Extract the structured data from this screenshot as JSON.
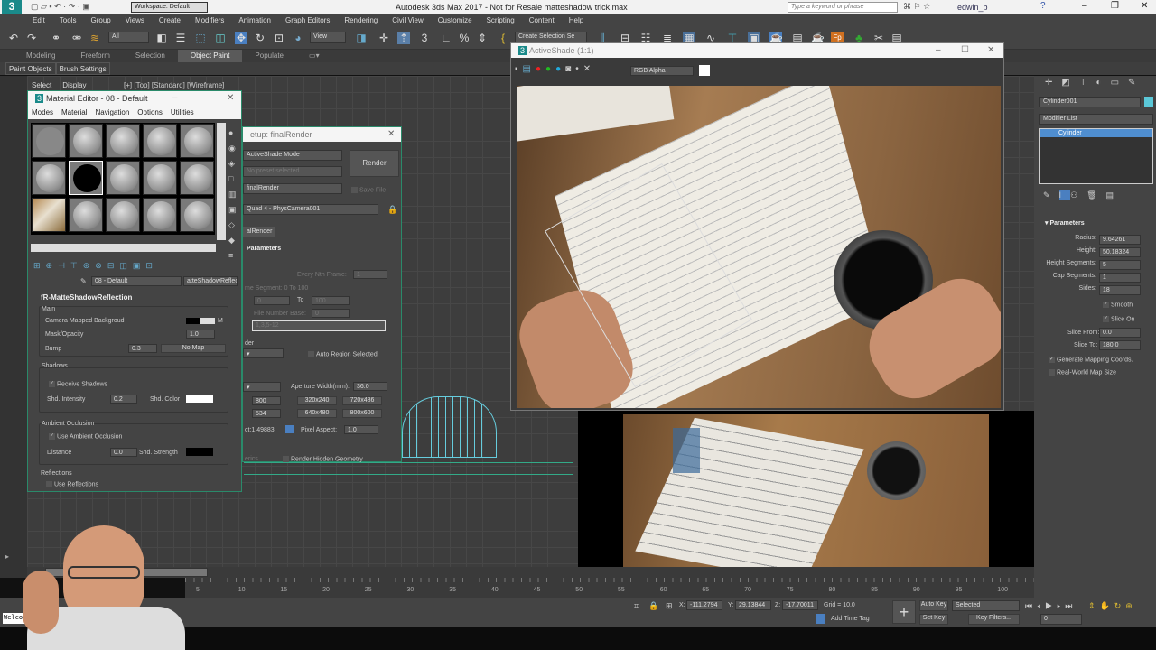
{
  "app": {
    "title": "Autodesk 3ds Max 2017 - Not for Resale   matteshadow trick.max",
    "workspace": "Workspace: Default",
    "search_placeholder": "Type a keyword or phrase",
    "user": "edwin_b"
  },
  "menu": [
    "Edit",
    "Tools",
    "Group",
    "Views",
    "Create",
    "Modifiers",
    "Animation",
    "Graph Editors",
    "Rendering",
    "Civil View",
    "Customize",
    "Scripting",
    "Content",
    "Help"
  ],
  "toolbar": {
    "filter": "All",
    "view": "View",
    "selection_set": "Create Selection Se"
  },
  "ribbon": {
    "tabs": [
      "Modeling",
      "Freeform",
      "Selection",
      "Object Paint",
      "Populate"
    ],
    "active": "Object Paint",
    "subtabs": [
      "Paint Objects",
      "Brush Settings"
    ]
  },
  "viewport": {
    "label": "[+] [Top] [Standard] [Wireframe]",
    "side_tabs": [
      "Select",
      "Display"
    ]
  },
  "material_editor": {
    "title": "Material Editor - 08 - Default",
    "menu": [
      "Modes",
      "Material",
      "Navigation",
      "Options",
      "Utilities"
    ],
    "material_name": "08 - Default",
    "material_type": "atteShadowReflec",
    "rollout": "fR-MatteShadowReflection",
    "main": {
      "title": "Main",
      "camera_bg": "Camera Mapped Backgroud",
      "camera_bg_btn": "M",
      "mask": "Mask/Opacity",
      "mask_val": "1.0",
      "bump": "Bump",
      "bump_val": "0.3",
      "bump_map": "No Map"
    },
    "shadows": {
      "title": "Shadows",
      "receive": "Receive Shadows",
      "intensity": "Shd. Intensity",
      "intensity_val": "0.2",
      "color": "Shd. Color"
    },
    "ao": {
      "title": "Ambient Occlusion",
      "use": "Use Ambient Occlusion",
      "distance": "Distance",
      "distance_val": "0.0",
      "strength": "Shd. Strength"
    },
    "reflections": {
      "title": "Reflections",
      "use": "Use Reflections"
    }
  },
  "render_setup": {
    "title": "etup: finalRender",
    "mode": "ActiveShade Mode",
    "preset": "No preset selected",
    "renderer": "finalRender",
    "render_btn": "Render",
    "save_file": "Save File",
    "view": "Quad 4 - PhysCamera001",
    "tab": "alRender",
    "rollout": "Parameters",
    "every_nth": "Every Nth Frame:",
    "every_nth_val": "1",
    "time_segment": "me Segment:  0 To 100",
    "from": "0",
    "to_lbl": "To",
    "to": "100",
    "file_base": "File Number Base:",
    "file_base_val": "0",
    "frames": "1,3,5-12",
    "section": "der",
    "auto_region": "Auto Region Selected",
    "aperture": "Aperture Width(mm):",
    "aperture_val": "36.0",
    "width": "800",
    "height": "534",
    "presets": [
      "320x240",
      "720x486",
      "640x480",
      "800x600"
    ],
    "aspect": "ct:1.49883",
    "pixel_aspect": "Pixel Aspect:",
    "pixel_aspect_val": "1.0",
    "erics": "erics",
    "hidden": "Render Hidden Geometry"
  },
  "activeshade": {
    "title": "ActiveShade (1:1)",
    "channel": "RGB Alpha"
  },
  "command_panel": {
    "object_name": "Cylinder001",
    "modifier_list": "Modifier List",
    "stack": [
      "Cylinder"
    ],
    "rollout": "Parameters",
    "params": [
      {
        "label": "Radius:",
        "value": "9.64261"
      },
      {
        "label": "Height:",
        "value": "50.18324"
      },
      {
        "label": "Height Segments:",
        "value": "5"
      },
      {
        "label": "Cap Segments:",
        "value": "1"
      },
      {
        "label": "Sides:",
        "value": "18"
      }
    ],
    "smooth": "Smooth",
    "slice_on": "Slice On",
    "slice_from": "Slice From:",
    "slice_from_val": "0.0",
    "slice_to": "Slice To:",
    "slice_to_val": "180.0",
    "gen_mapping": "Generate Mapping Coords.",
    "real_world": "Real-World Map Size",
    "color": "#5bc8d8"
  },
  "timeline": {
    "slider": "0 / 100",
    "ticks": [
      "5",
      "10",
      "15",
      "20",
      "25",
      "30",
      "35",
      "40",
      "45",
      "50",
      "55",
      "60",
      "65",
      "70",
      "75",
      "80",
      "85",
      "90",
      "95",
      "100"
    ]
  },
  "status": {
    "x": "-111.2794",
    "y": "29.13844",
    "z": "-17.70011",
    "grid": "Grid = 10.0",
    "add_time_tag": "Add Time Tag",
    "auto_key": "Auto Key",
    "set_key": "Set Key",
    "key_mode": "Selected",
    "key_filters": "Key Filters...",
    "frame": "0",
    "welcome": "Welcome"
  }
}
